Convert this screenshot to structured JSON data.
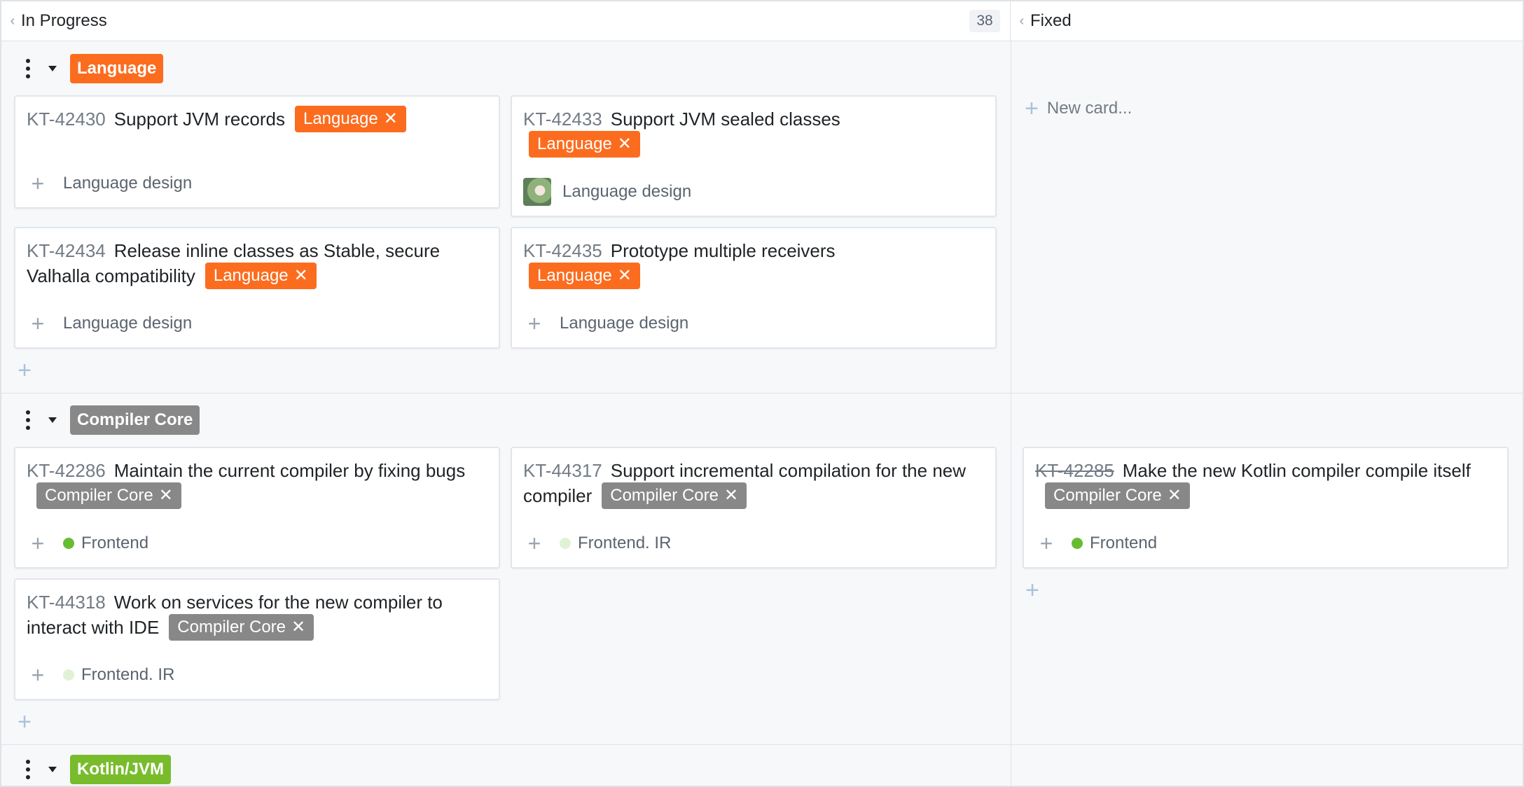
{
  "columns": [
    {
      "title": "In Progress",
      "count": "38",
      "collapse_icon": "chevron-left-icon"
    },
    {
      "title": "Fixed",
      "collapse_icon": "chevron-left-icon"
    }
  ],
  "icons": {
    "lane_menu": "vertical-dots-icon",
    "lane_toggle": "caret-down-icon",
    "add": "plus-icon",
    "remove_tag": "close-icon"
  },
  "colors": {
    "language": "#fc6c1f",
    "compiler_core": "#888888",
    "kotlin_jvm": "#78bc2c",
    "frontend_dot": "#68bc34",
    "frontend_ir_dot": "#dff2d6"
  },
  "new_card_label": "New card...",
  "swimlanes": [
    {
      "name": "Language",
      "cards": [
        {
          "id": "KT-42430",
          "title": "Support JVM records",
          "tag": "Language",
          "subsystem": "Language design"
        },
        {
          "id": "KT-42433",
          "title": "Support JVM sealed classes",
          "tag": "Language",
          "subsystem": "Language design",
          "has_avatar": true
        },
        {
          "id": "KT-42434",
          "title": "Release inline classes as Stable, secure Valhalla compatibility",
          "tag": "Language",
          "subsystem": "Language design"
        },
        {
          "id": "KT-42435",
          "title": "Prototype multiple receivers",
          "tag": "Language",
          "subsystem": "Language design"
        }
      ]
    },
    {
      "name": "Compiler Core",
      "cards": [
        {
          "id": "KT-42286",
          "title": "Maintain the current compiler by fixing bugs",
          "tag": "Compiler Core",
          "subsystem": "Frontend"
        },
        {
          "id": "KT-44317",
          "title": "Support incremental compilation for the new compiler",
          "tag": "Compiler Core",
          "subsystem": "Frontend. IR"
        },
        {
          "id": "KT-42285",
          "title": "Make the new Kotlin compiler compile itself",
          "tag": "Compiler Core",
          "subsystem": "Frontend",
          "resolved": true
        },
        {
          "id": "KT-44318",
          "title": "Work on services for the new compiler to interact with IDE",
          "tag": "Compiler Core",
          "subsystem": "Frontend. IR"
        }
      ]
    },
    {
      "name": "Kotlin/JVM",
      "cards": []
    }
  ],
  "tag_close_glyph": "✕"
}
